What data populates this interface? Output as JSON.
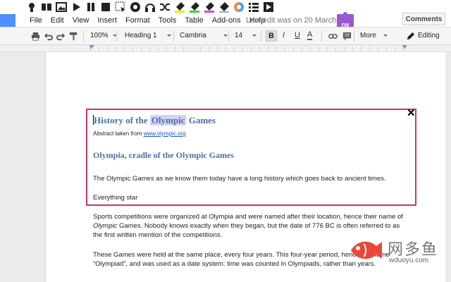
{
  "menu": {
    "items": [
      "File",
      "Edit",
      "View",
      "Insert",
      "Format",
      "Tools",
      "Table",
      "Add-ons",
      "Help"
    ],
    "last_edit": "Last edit was on 20 March",
    "rw_badge": "rw",
    "comments": "Comments"
  },
  "toolbar": {
    "zoom": "100%",
    "style": "Heading 1",
    "font": "Cambria",
    "size": "14",
    "bold": "B",
    "italic": "I",
    "underline": "U",
    "text_color": "A",
    "more": "More",
    "mode": "Editing"
  },
  "overlay": {
    "title_prefix": "History of the",
    "title_highlight": "Olympic",
    "title_suffix": "Games",
    "abstract_label": "Abstract taken from",
    "abstract_link": "www.olympic.org",
    "subtitle": "Olympia, cradle of the Olympic Games",
    "paragraph1": "The Olympic Games as we know them today have a long history which goes back to ancient times.",
    "paragraph2": "Everything star",
    "close": "✕"
  },
  "document": {
    "para1_a": "Sports competitions were organized at Olympia and were named after their location, hence their name of",
    "para1_em": "Olympic",
    "para1_b": "Games. Nobody knows exactly when they began, but the date of 776 BC is often referred to as the first written mention of the competitions.",
    "para2": "These Games were held at the same place, every four years. This four-year period, hence the name “Olympiad”, and was used as a date system: time was counted in Olympiads, rather than years."
  },
  "watermark": {
    "title": "网多鱼",
    "subtitle": "wduoyu.com"
  },
  "colors": {
    "accent_blue": "#4d90fe",
    "overlay_border": "#d0336a",
    "heading_blue": "#4a6fa5",
    "highlight": "#d6d2f5",
    "rw_purple": "#9b59d0",
    "watermark_red": "#e8473a"
  }
}
